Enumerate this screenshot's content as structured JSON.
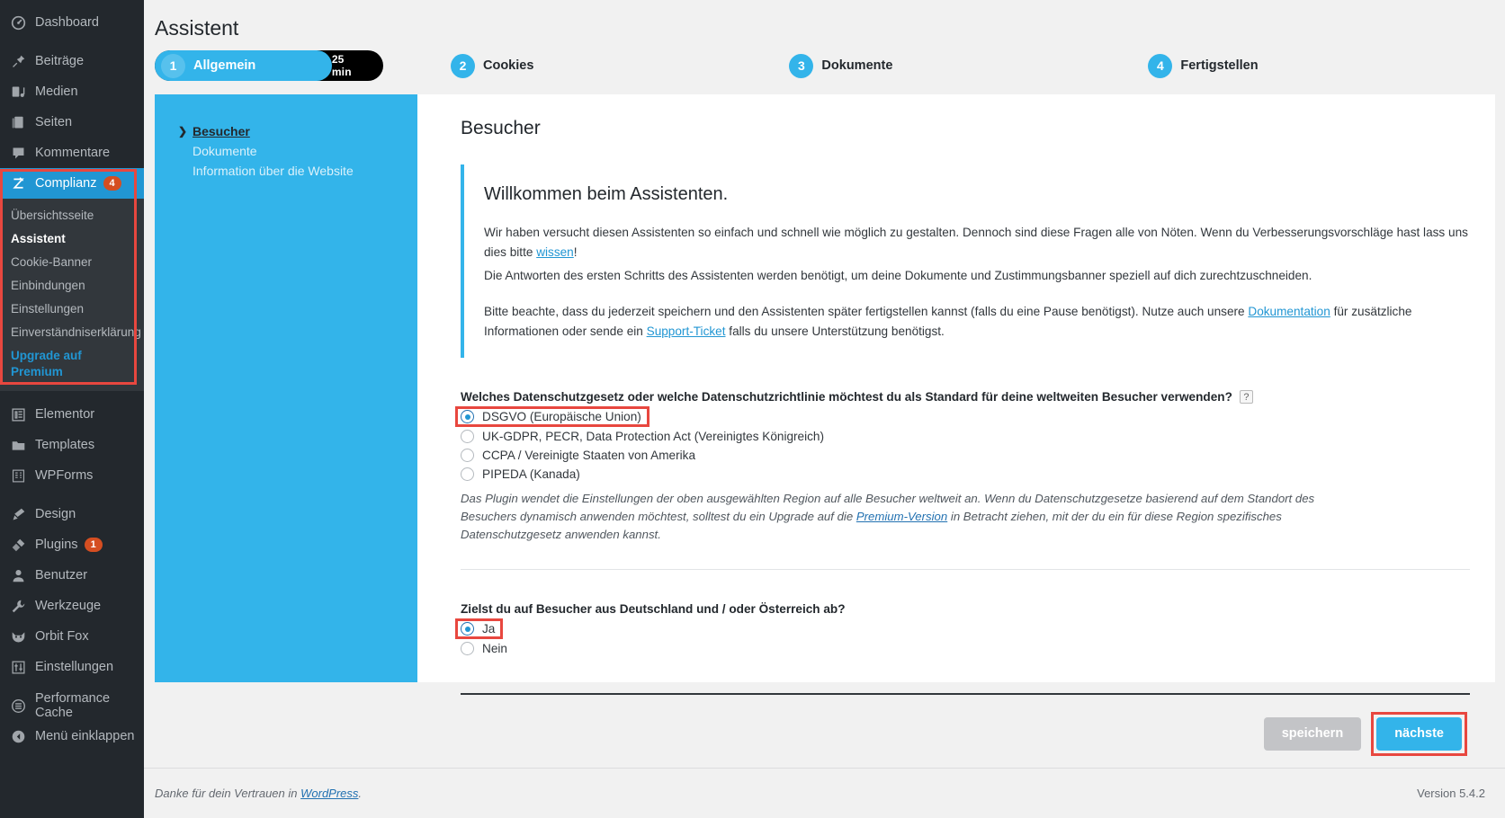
{
  "sidebar": {
    "items": [
      {
        "label": "Dashboard",
        "icon": "dashboard-icon"
      },
      {
        "label": "Beiträge",
        "icon": "posts-pin-icon"
      },
      {
        "label": "Medien",
        "icon": "media-icon"
      },
      {
        "label": "Seiten",
        "icon": "pages-icon"
      },
      {
        "label": "Kommentare",
        "icon": "comments-icon"
      }
    ],
    "complianz": {
      "label": "Complianz",
      "badge": "4",
      "icon": "complianz-z-icon"
    },
    "submenu": [
      {
        "label": "Übersichtsseite",
        "state": "normal"
      },
      {
        "label": "Assistent",
        "state": "active"
      },
      {
        "label": "Cookie-Banner",
        "state": "normal"
      },
      {
        "label": "Einbindungen",
        "state": "normal"
      },
      {
        "label": "Einstellungen",
        "state": "normal"
      },
      {
        "label": "Einverständniserklärung",
        "state": "normal"
      },
      {
        "label": "Upgrade auf Premium",
        "state": "premium"
      }
    ],
    "items2": [
      {
        "label": "Elementor",
        "icon": "elementor-icon"
      },
      {
        "label": "Templates",
        "icon": "folder-icon"
      },
      {
        "label": "WPForms",
        "icon": "wpforms-icon"
      }
    ],
    "items3": [
      {
        "label": "Design",
        "icon": "appearance-brush-icon"
      },
      {
        "label": "Plugins",
        "icon": "plugins-plug-icon",
        "badge": "1"
      },
      {
        "label": "Benutzer",
        "icon": "users-icon"
      },
      {
        "label": "Werkzeuge",
        "icon": "tools-wrench-icon"
      },
      {
        "label": "Orbit Fox",
        "icon": "orbit-fox-icon"
      },
      {
        "label": "Einstellungen",
        "icon": "settings-sliders-icon"
      }
    ],
    "items4": [
      {
        "label": "Performance Cache",
        "icon": "performance-cache-icon"
      }
    ],
    "collapse": {
      "label": "Menü einklappen",
      "icon": "collapse-arrow-icon"
    }
  },
  "header": {
    "title": "Assistent",
    "steps": [
      {
        "num": "1",
        "label": "Allgemein",
        "time": "25 min"
      },
      {
        "num": "2",
        "label": "Cookies"
      },
      {
        "num": "3",
        "label": "Dokumente"
      },
      {
        "num": "4",
        "label": "Fertigstellen"
      }
    ]
  },
  "wizard_nav": [
    {
      "label": "Besucher",
      "state": "active"
    },
    {
      "label": "Dokumente",
      "state": "normal"
    },
    {
      "label": "Information über die Website",
      "state": "normal"
    }
  ],
  "content": {
    "section_title": "Besucher",
    "intro_heading": "Willkommen beim Assistenten.",
    "p1_a": "Wir haben versucht diesen Assistenten so einfach und schnell wie möglich zu gestalten. Dennoch sind diese Fragen alle von Nöten. Wenn du Verbesserungsvorschläge hast lass uns dies bitte ",
    "p1_link": "wissen",
    "p1_b": "!",
    "p2": "Die Antworten des ersten Schritts des Assistenten werden benötigt, um deine Dokumente und Zustimmungsbanner speziell auf dich zurechtzuschneiden.",
    "p3_a": "Bitte beachte, dass du jederzeit speichern und den Assistenten später fertigstellen kannst (falls du eine Pause benötigst). Nutze auch unsere ",
    "p3_link1": "Dokumentation",
    "p3_b": " für zusätzliche Informationen oder sende ein ",
    "p3_link2": "Support-Ticket",
    "p3_c": " falls du unsere Unterstützung benötigst.",
    "question1": {
      "label": "Welches Datenschutzgesetz oder welche Datenschutzrichtlinie möchtest du als Standard für deine weltweiten Besucher verwenden?",
      "help": "?",
      "options": [
        {
          "label": "DSGVO (Europäische Union)",
          "selected": true,
          "highlighted": true
        },
        {
          "label": "UK-GDPR, PECR, Data Protection Act (Vereinigtes Königreich)",
          "selected": false,
          "highlighted": false
        },
        {
          "label": "CCPA / Vereinigte Staaten von Amerika",
          "selected": false,
          "highlighted": false
        },
        {
          "label": "PIPEDA (Kanada)",
          "selected": false,
          "highlighted": false
        }
      ],
      "note_a": "Das Plugin wendet die Einstellungen der oben ausgewählten Region auf alle Besucher weltweit an. Wenn du Datenschutzgesetze basierend auf dem Standort des Besuchers dynamisch anwenden möchtest, solltest du ein Upgrade auf die ",
      "note_link": "Premium-Version",
      "note_b": " in Betracht ziehen, mit der du ein für diese Region spezifisches Datenschutzgesetz anwenden kannst."
    },
    "question2": {
      "label": "Zielst du auf Besucher aus Deutschland und / oder Österreich ab?",
      "options": [
        {
          "label": "Ja",
          "selected": true,
          "highlighted": true
        },
        {
          "label": "Nein",
          "selected": false,
          "highlighted": false
        }
      ]
    },
    "buttons": {
      "save": "speichern",
      "next": "nächste"
    }
  },
  "footer": {
    "thanks_a": "Danke für dein Vertrauen in ",
    "thanks_link": "WordPress",
    "thanks_b": ".",
    "version": "Version 5.4.2"
  },
  "colors": {
    "accent_blue": "#33b4ea",
    "admin_dark": "#23282d",
    "highlight_red": "#e8473f",
    "badge_orange": "#d54e21"
  }
}
